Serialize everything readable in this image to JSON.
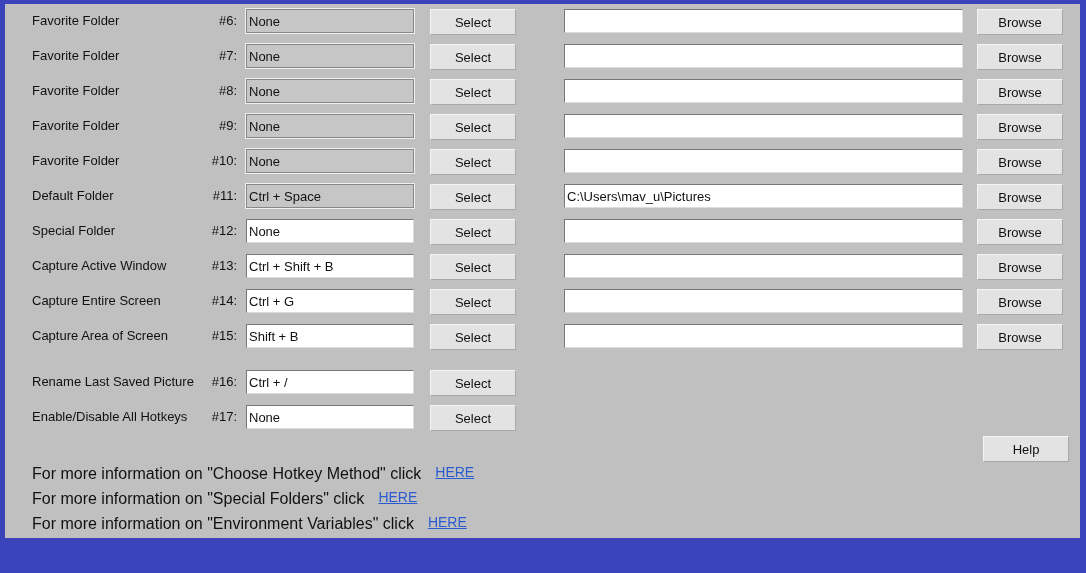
{
  "rows": [
    {
      "kind": "folder",
      "label": "Favorite Folder",
      "number": "#6:",
      "hotkey": "None",
      "disabled": true,
      "select_button": "Select",
      "browse_button": "Browse"
    },
    {
      "kind": "folder",
      "label": "Favorite Folder",
      "number": "#7:",
      "hotkey": "None",
      "disabled": true,
      "select_button": "Select",
      "browse_button": "Browse"
    },
    {
      "kind": "folder",
      "label": "Favorite Folder",
      "number": "#8:",
      "hotkey": "None",
      "disabled": true,
      "select_button": "Select",
      "browse_button": "Browse"
    },
    {
      "kind": "folder",
      "label": "Favorite Folder",
      "number": "#9:",
      "hotkey": "None",
      "disabled": true,
      "select_button": "Select",
      "browse_button": "Browse"
    },
    {
      "kind": "folder",
      "label": "Favorite Folder",
      "number": "#10:",
      "hotkey": "None",
      "disabled": true,
      "select_button": "Select",
      "browse_button": "Browse"
    },
    {
      "kind": "folder",
      "label": "Default Folder",
      "number": "#11:",
      "hotkey": "Ctrl + Space",
      "disabled": true,
      "select_button": "Select",
      "path": "C:\\Users\\mav_u\\Pictures",
      "browse_button": "Browse"
    },
    {
      "kind": "folder",
      "label": "Special Folder",
      "number": "#12:",
      "hotkey": "None",
      "disabled": false,
      "select_button": "Select",
      "browse_button": "Browse"
    },
    {
      "kind": "folder",
      "label": "Capture Active Window",
      "number": "#13:",
      "hotkey": "Ctrl + Shift + B",
      "disabled": false,
      "select_button": "Select",
      "browse_button": "Browse"
    },
    {
      "kind": "folder",
      "label": "Capture Entire Screen",
      "number": "#14:",
      "hotkey": "Ctrl + G",
      "disabled": false,
      "select_button": "Select",
      "browse_button": "Browse"
    },
    {
      "kind": "folder",
      "label": "Capture Area of Screen",
      "number": "#15:",
      "hotkey": "Shift + B",
      "disabled": false,
      "select_button": "Select",
      "browse_button": "Browse"
    },
    {
      "kind": "action",
      "label": "Rename Last Saved Picture",
      "number": "#16:",
      "hotkey": "Ctrl + /",
      "disabled": false,
      "select_button": "Select"
    },
    {
      "kind": "action",
      "label": "Enable/Disable All Hotkeys",
      "number": "#17:",
      "hotkey": "None",
      "disabled": false,
      "select_button": "Select"
    }
  ],
  "help_button": "Help",
  "info_lines": [
    {
      "text": "For more information on \"Choose Hotkey Method\" click",
      "link": "HERE"
    },
    {
      "text": "For more information on \"Special Folders\" click",
      "link": "HERE"
    },
    {
      "text": "For more information on \"Environment Variables\" click",
      "link": "HERE"
    }
  ]
}
